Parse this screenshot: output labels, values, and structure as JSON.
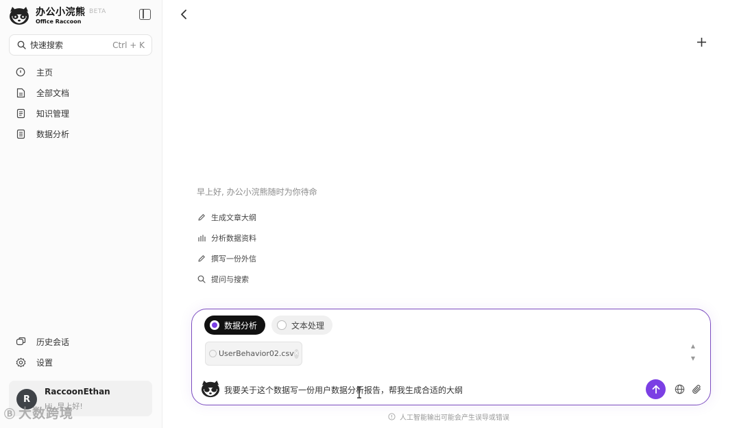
{
  "brand": {
    "name": "办公小浣熊",
    "subtitle": "Office Raccoon",
    "badge": "BETA"
  },
  "search": {
    "label": "快速搜索",
    "shortcut": "Ctrl + K"
  },
  "nav": [
    {
      "label": "主页",
      "icon": "home-icon"
    },
    {
      "label": "全部文档",
      "icon": "document-icon"
    },
    {
      "label": "知识管理",
      "icon": "knowledge-icon"
    },
    {
      "label": "数据分析",
      "icon": "data-analysis-icon"
    }
  ],
  "bottom_nav": [
    {
      "label": "历史会话",
      "icon": "history-icon"
    },
    {
      "label": "设置",
      "icon": "settings-icon"
    }
  ],
  "user": {
    "initial": "R",
    "name": "RaccoonEthan",
    "greeting": "Hi, 早上好!"
  },
  "watermark": {
    "logo": "Ⓑ",
    "text": "大数跨境"
  },
  "main": {
    "greeting": "早上好, 办公小浣熊随时为你待命",
    "suggestions": [
      {
        "label": "生成文章大纲",
        "icon": "pencil-icon"
      },
      {
        "label": "分析数据资料",
        "icon": "bar-chart-icon"
      },
      {
        "label": "撰写一份外信",
        "icon": "pencil-icon"
      },
      {
        "label": "提问与搜索",
        "icon": "search-icon"
      }
    ]
  },
  "composer": {
    "modes": [
      {
        "label": "数据分析",
        "active": true
      },
      {
        "label": "文本处理",
        "active": false
      }
    ],
    "file_name": "UserBehavior02.csv",
    "input_text": "我要关于这个数据写一份用户数据分析报告，帮我生成合适的大纲"
  },
  "disclaimer": "人工智能输出可能会产生误导或错误",
  "colors": {
    "accent": "#7b3fe4",
    "border": "#7b4cc0"
  }
}
